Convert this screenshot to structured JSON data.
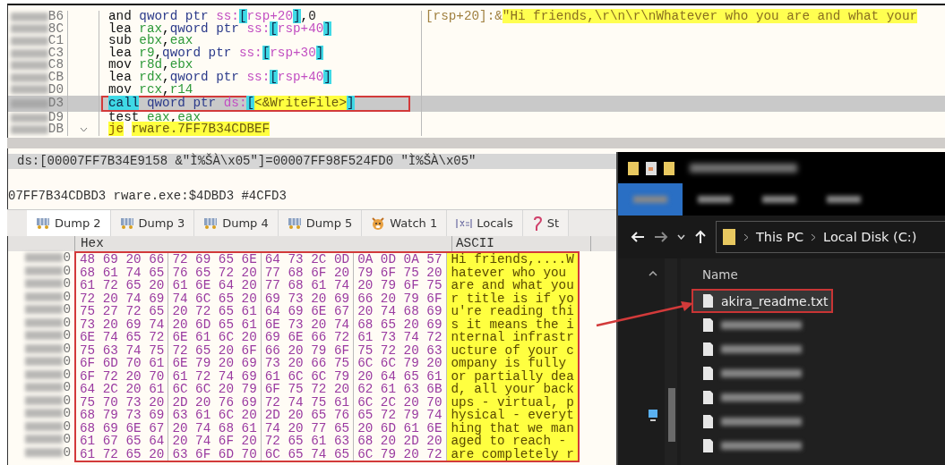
{
  "disassembly": {
    "rows": [
      {
        "address_suffix": "B6",
        "kind": "plain",
        "selected": false,
        "boxed": false,
        "mnemonic": "and",
        "operands": "qword ptr ss:[rsp+20],0",
        "comment_ref": "[rsp+20]:&",
        "comment_string": "\"Hi friends,\\r\\n\\r\\nWhatever who you are and what your"
      },
      {
        "address_suffix": "8C",
        "kind": "plain",
        "selected": false,
        "boxed": false,
        "mnemonic": "lea",
        "operands": "rax,qword ptr ss:[rsp+40]"
      },
      {
        "address_suffix": "C1",
        "kind": "plain",
        "selected": false,
        "boxed": false,
        "mnemonic": "sub",
        "operands": "ebx,eax"
      },
      {
        "address_suffix": "C3",
        "kind": "plain",
        "selected": false,
        "boxed": false,
        "mnemonic": "lea",
        "operands": "r9,qword ptr ss:[rsp+30]"
      },
      {
        "address_suffix": "C8",
        "kind": "plain",
        "selected": false,
        "boxed": false,
        "mnemonic": "mov",
        "operands": "r8d,ebx"
      },
      {
        "address_suffix": "CB",
        "kind": "plain",
        "selected": false,
        "boxed": false,
        "mnemonic": "lea",
        "operands": "rdx,qword ptr ss:[rsp+40]"
      },
      {
        "address_suffix": "D0",
        "kind": "plain",
        "selected": false,
        "boxed": false,
        "mnemonic": "mov",
        "operands": "rcx,r14"
      },
      {
        "address_suffix": "D3",
        "kind": "call",
        "selected": true,
        "boxed": true,
        "mnemonic": "call",
        "operands": "qword ptr ds:[<&WriteFile>]"
      },
      {
        "address_suffix": "D9",
        "kind": "plain",
        "selected": false,
        "boxed": false,
        "mnemonic": "test",
        "operands": "eax,eax"
      },
      {
        "address_suffix": "DB",
        "kind": "jump",
        "selected": false,
        "boxed": false,
        "mnemonic": "je",
        "operands": "rware.7FF7B34CDBEF"
      }
    ]
  },
  "info": {
    "expression": "ds:[00007FF7B34E9158 &\"Ì%ŠÀ\\x05\"]=00007FF98F524FD0 \"Ì%ŠÀ\\x05\"",
    "location": "07FF7B34CDBD3 rware.exe:$4DBD3 #4CFD3"
  },
  "tabs": [
    {
      "label": "Dump 2",
      "kind": "dump",
      "selected": true
    },
    {
      "label": "Dump 3",
      "kind": "dump",
      "selected": false
    },
    {
      "label": "Dump 4",
      "kind": "dump",
      "selected": false
    },
    {
      "label": "Dump 5",
      "kind": "dump",
      "selected": false
    },
    {
      "label": "Watch 1",
      "kind": "watch",
      "selected": false
    },
    {
      "label": "Locals",
      "kind": "locals",
      "selected": false
    },
    {
      "label": "St",
      "kind": "struct",
      "selected": false
    }
  ],
  "dump": {
    "hex_header": "Hex",
    "ascii_header": "ASCII",
    "boxed": true,
    "rows": [
      {
        "address_suffix": "0",
        "hex": "48 69 20 66 72 69 65 6E 64 73 2C 0D 0A 0D 0A 57",
        "ascii": "Hi friends,....W"
      },
      {
        "address_suffix": "0",
        "hex": "68 61 74 65 76 65 72 20 77 68 6F 20 79 6F 75 20",
        "ascii": "hatever who you "
      },
      {
        "address_suffix": "0",
        "hex": "61 72 65 20 61 6E 64 20 77 68 61 74 20 79 6F 75",
        "ascii": "are and what you"
      },
      {
        "address_suffix": "0",
        "hex": "72 20 74 69 74 6C 65 20 69 73 20 69 66 20 79 6F",
        "ascii": "r title is if yo"
      },
      {
        "address_suffix": "0",
        "hex": "75 27 72 65 20 72 65 61 64 69 6E 67 20 74 68 69",
        "ascii": "u're reading thi"
      },
      {
        "address_suffix": "0",
        "hex": "73 20 69 74 20 6D 65 61 6E 73 20 74 68 65 20 69",
        "ascii": "s it means the i"
      },
      {
        "address_suffix": "0",
        "hex": "6E 74 65 72 6E 61 6C 20 69 6E 66 72 61 73 74 72",
        "ascii": "nternal infrastr"
      },
      {
        "address_suffix": "0",
        "hex": "75 63 74 75 72 65 20 6F 66 20 79 6F 75 72 20 63",
        "ascii": "ucture of your c"
      },
      {
        "address_suffix": "0",
        "hex": "6F 6D 70 61 6E 79 20 69 73 20 66 75 6C 6C 79 20",
        "ascii": "ompany is fully "
      },
      {
        "address_suffix": "0",
        "hex": "6F 72 20 70 61 72 74 69 61 6C 6C 79 20 64 65 61",
        "ascii": "or partially dea"
      },
      {
        "address_suffix": "0",
        "hex": "64 2C 20 61 6C 6C 20 79 6F 75 72 20 62 61 63 6B",
        "ascii": "d, all your back"
      },
      {
        "address_suffix": "0",
        "hex": "75 70 73 20 2D 20 76 69 72 74 75 61 6C 2C 20 70",
        "ascii": "ups - virtual, p"
      },
      {
        "address_suffix": "0",
        "hex": "68 79 73 69 63 61 6C 20 2D 20 65 76 65 72 79 74",
        "ascii": "hysical - everyt"
      },
      {
        "address_suffix": "0",
        "hex": "68 69 6E 67 20 74 68 61 74 20 77 65 20 6D 61 6E",
        "ascii": "hing that we man"
      },
      {
        "address_suffix": "0",
        "hex": "61 67 65 64 20 74 6F 20 72 65 61 63 68 20 2D 20",
        "ascii": "aged to reach - "
      },
      {
        "address_suffix": "0",
        "hex": "61 72 65 20 63 6F 6D 70 6C 65 74 65 6C 79 20 72",
        "ascii": "are completely r"
      }
    ]
  },
  "annotation_arrow": true,
  "explorer": {
    "ribbon_tabs": [
      {
        "selected": true
      },
      {
        "selected": false
      },
      {
        "selected": false
      },
      {
        "selected": false
      }
    ],
    "breadcrumb": [
      "This PC",
      "Local Disk (C:)"
    ],
    "column_header": "Name",
    "files": [
      {
        "name": "akira_readme.txt",
        "redacted": false,
        "selected": true,
        "boxed": true
      },
      {
        "redacted": true,
        "selected": false,
        "boxed": false
      },
      {
        "redacted": true,
        "selected": false,
        "boxed": false
      },
      {
        "redacted": true,
        "selected": false,
        "boxed": false
      },
      {
        "redacted": true,
        "selected": false,
        "boxed": false
      },
      {
        "redacted": true,
        "selected": false,
        "boxed": false
      },
      {
        "redacted": true,
        "selected": false,
        "boxed": false
      }
    ]
  }
}
